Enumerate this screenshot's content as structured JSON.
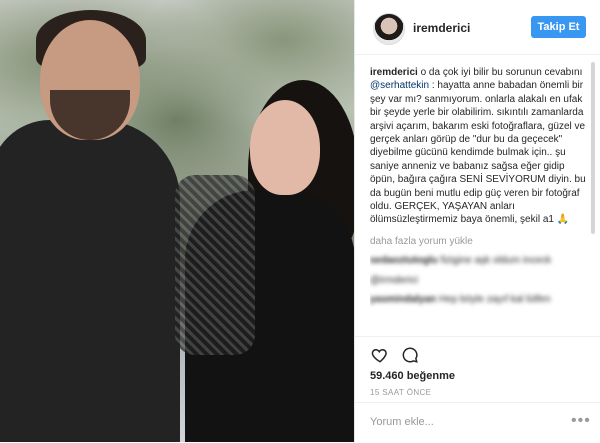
{
  "post": {
    "username": "iremderici",
    "follow_label": "Takip Et",
    "caption_user": "iremderici",
    "caption_parts": {
      "a": " o da çok iyi bilir bu sorunun cevabını ",
      "mention": "@serhattekin",
      "b": " : hayatta anne babadan önemli bir şey var mı? sanmıyorum. onlarla alakalı en ufak bir şeyde yerle bir olabilirim. sıkıntılı zamanlarda arşivi açarım, bakarım eski fotoğraflara, güzel ve gerçek anları görüp de \"dur bu da geçecek\" diyebilme gücünü kendimde bulmak için.. şu saniye anneniz ve babanız sağsa eğer gidip öpün, bağıra çağıra SENİ SEVİYORUM diyin. bu da bugün beni mutlu edip güç veren bir fotoğraf oldu. GERÇEK, YAŞAYAN anları ölümsüzleştirmemiz baya önemli, şekil a1 🙏"
    },
    "more_comments_label": "daha fazla yorum yükle",
    "blurred_comments": [
      {
        "user": "sedaoztutoglu",
        "text": " fizigine aşk oldum inceck"
      },
      {
        "user": "",
        "text": "@irmderici"
      },
      {
        "user": "yasmindalyan",
        "text": " Hep böyle zayıf kal lütfen"
      }
    ],
    "likes_text": "59.460 beğenme",
    "time_text": "15 SAAT ÖNCE",
    "comment_placeholder": "Yorum ekle...",
    "more_icon_text": "•••"
  },
  "colors": {
    "follow_button": "#3897f0",
    "mention": "#003569",
    "muted": "#999999"
  },
  "icons": [
    "heart-icon",
    "comment-icon",
    "more-options-icon"
  ]
}
